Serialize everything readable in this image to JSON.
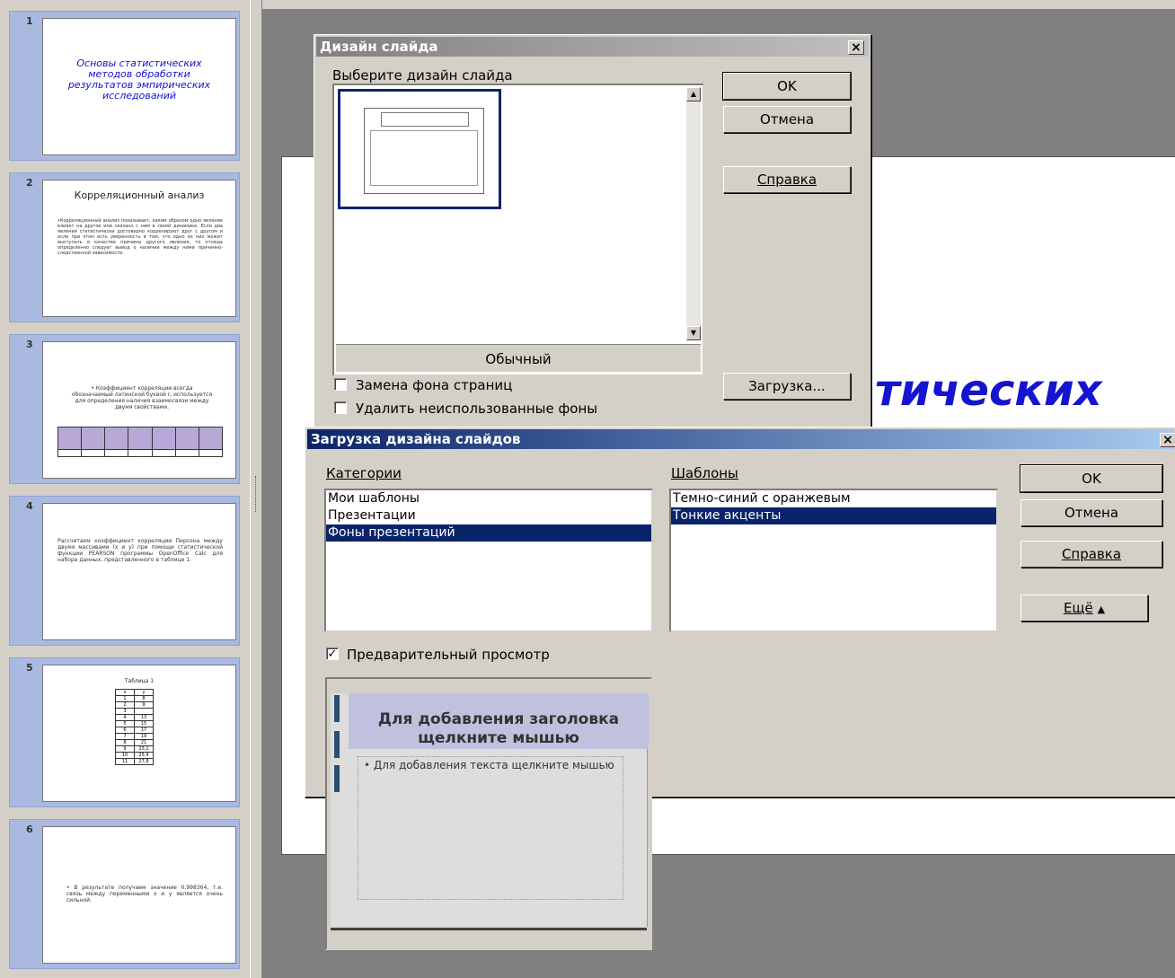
{
  "slides": [
    {
      "num": "1",
      "title": "Основы статистических методов обработки результатов эмпирических исследований"
    },
    {
      "num": "2",
      "title": "Корреляционный анализ",
      "body": "•Корреляционный анализ показывает, каким образом одно явление влияет на другое или связано с ним в своей динамике. Если два явления статистически достоверно коррелируют друг с другом и если при этом есть уверенность в том, что одно из них может выступать в качестве причины другого явления, то отсюда определенно следует вывод о наличии между ними причинно-следственной зависимости."
    },
    {
      "num": "3",
      "body": "• Коэффициент корреляции всегда обозначаемый латинской буквой r, используется для определения наличия взаимосвязи между двумя свойствами."
    },
    {
      "num": "4",
      "body": "Рассчитаем коэффициент корреляции Пирсона между двумя массивами (x и y) при помощи статистической функции PEARSON программы OpenOffice Calc для набора данных, представленного в таблице 1."
    },
    {
      "num": "5",
      "title": "Таблица 1",
      "table": [
        [
          "x",
          "y"
        ],
        [
          "1",
          "8"
        ],
        [
          "2",
          "9"
        ],
        [
          "3",
          ""
        ],
        [
          "4",
          "13"
        ],
        [
          "5",
          "15"
        ],
        [
          "6",
          "17"
        ],
        [
          "7",
          "19"
        ],
        [
          "8",
          "21"
        ],
        [
          "9",
          "23,1"
        ],
        [
          "10",
          "25,4"
        ],
        [
          "11",
          "27,8"
        ]
      ]
    },
    {
      "num": "6",
      "body": "• В результате получаем значение 0,998364, т.е. связь между переменными x и y является очень сильной."
    }
  ],
  "main_slide": {
    "title_fragment": "тических"
  },
  "design_dialog": {
    "title": "Дизайн слайда",
    "close": "×",
    "choose_label": "Выберите дизайн слайда",
    "design_name": "Обычный",
    "ok": "OK",
    "cancel": "Отмена",
    "help": "Справка",
    "load": "Загрузка...",
    "replace_bg": "Замена фона страниц",
    "delete_unused": "Удалить неиспользованные фоны"
  },
  "load_dialog": {
    "title": "Загрузка дизайна слайдов",
    "close": "×",
    "categories_label": "Категории",
    "categories": [
      "Мои шаблоны",
      "Презентации",
      "Фоны презентаций"
    ],
    "selected_category": "Фоны презентаций",
    "templates_label": "Шаблоны",
    "templates": [
      "Темно-синий с оранжевым",
      "Тонкие акценты"
    ],
    "selected_template": "Тонкие акценты",
    "ok": "OK",
    "cancel": "Отмена",
    "help": "Справка",
    "more": "Ещё",
    "preview_label": "Предварительный просмотр",
    "preview_checked": true,
    "preview_title": "Для добавления заголовка щелкните мышью",
    "preview_body": "Для добавления текста щелкните мышью"
  }
}
